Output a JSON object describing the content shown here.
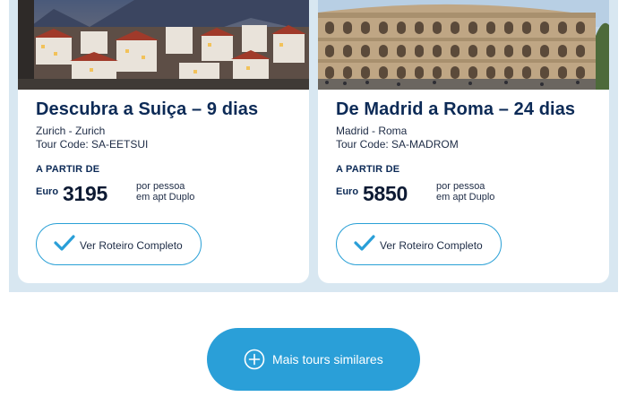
{
  "tours": [
    {
      "title": "Descubra a Suiça – 9 dias",
      "route": "Zurich - Zurich",
      "tour_code": "Tour Code: SA-EETSUI",
      "from_label": "A PARTIR DE",
      "currency": "Euro",
      "price": "3195",
      "per_person": "por pessoa",
      "room_type": "em apt Duplo",
      "button_label": "Ver Roteiro Completo"
    },
    {
      "title": "De Madrid a Roma – 24 dias",
      "route": "Madrid - Roma",
      "tour_code": "Tour Code: SA-MADROM",
      "from_label": "A PARTIR DE",
      "currency": "Euro",
      "price": "5850",
      "per_person": "por pessoa",
      "room_type": "em apt Duplo",
      "button_label": "Ver Roteiro Completo"
    }
  ],
  "more_button": {
    "label": "Mais tours similares"
  },
  "colors": {
    "accent": "#2a9fd8",
    "title": "#0c2a56",
    "band": "#d8e7f1"
  }
}
